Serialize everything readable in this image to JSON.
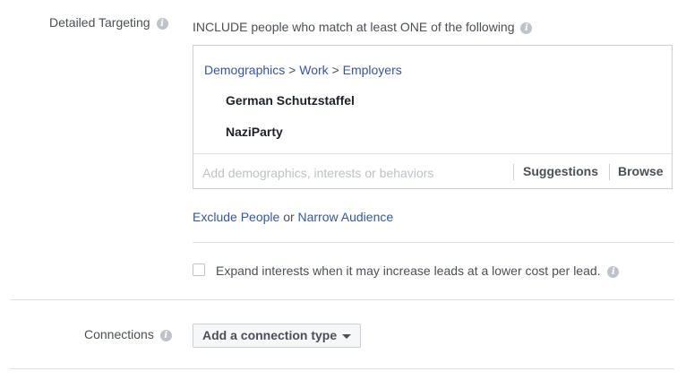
{
  "detailed_targeting": {
    "label": "Detailed Targeting",
    "info_icon": "info-icon",
    "include_text": "INCLUDE people who match at least ONE of the following",
    "breadcrumb": {
      "part1": "Demographics",
      "part2": "Work",
      "part3": "Employers",
      "separator": ">"
    },
    "items": [
      "German Schutzstaffel",
      "NaziParty"
    ],
    "search_placeholder": "Add demographics, interests or behaviors",
    "suggestions_label": "Suggestions",
    "browse_label": "Browse",
    "exclude_link": "Exclude People",
    "or_text": "or",
    "narrow_link": "Narrow Audience",
    "expand_text": "Expand interests when it may increase leads at a lower cost per lead.",
    "expand_checked": false
  },
  "connections": {
    "label": "Connections",
    "dropdown_label": "Add a connection type"
  },
  "colors": {
    "link": "#365899",
    "text": "#4b4f56",
    "border": "#ccd0d5"
  }
}
